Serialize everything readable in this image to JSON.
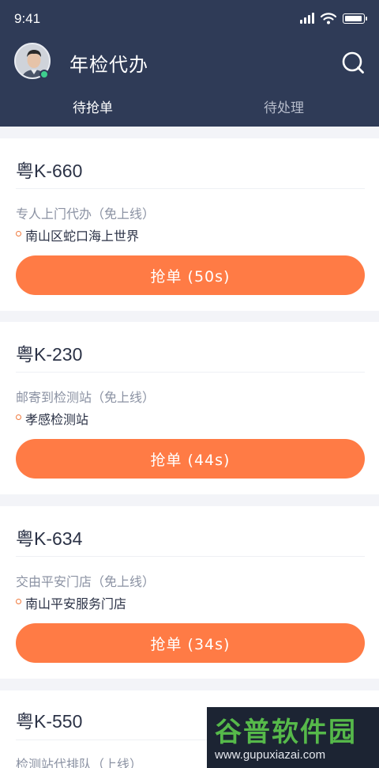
{
  "status_bar": {
    "time": "9:41"
  },
  "header": {
    "title": "年检代办",
    "search_icon": "search-icon"
  },
  "tabs": [
    {
      "label": "待抢单",
      "active": true
    },
    {
      "label": "待处理",
      "active": false
    }
  ],
  "orders": [
    {
      "plate": "粤K-660",
      "service": "专人上门代办（免上线）",
      "location": "南山区蛇口海上世界",
      "button": "抢单 (50s)"
    },
    {
      "plate": "粤K-230",
      "service": "邮寄到检测站（免上线）",
      "location": "孝感检测站",
      "button": "抢单 (44s)"
    },
    {
      "plate": "粤K-634",
      "service": "交由平安门店（免上线）",
      "location": "南山平安服务门店",
      "button": "抢单 (34s)"
    },
    {
      "plate": "粤K-550",
      "service": "检测站代排队（上线）"
    }
  ],
  "watermark": {
    "brand": "谷普软件园",
    "url": "www.gupuxiazai.com"
  },
  "colors": {
    "header_bg": "#2f3b57",
    "accent": "#ff7b45",
    "online": "#3ecf8e"
  }
}
